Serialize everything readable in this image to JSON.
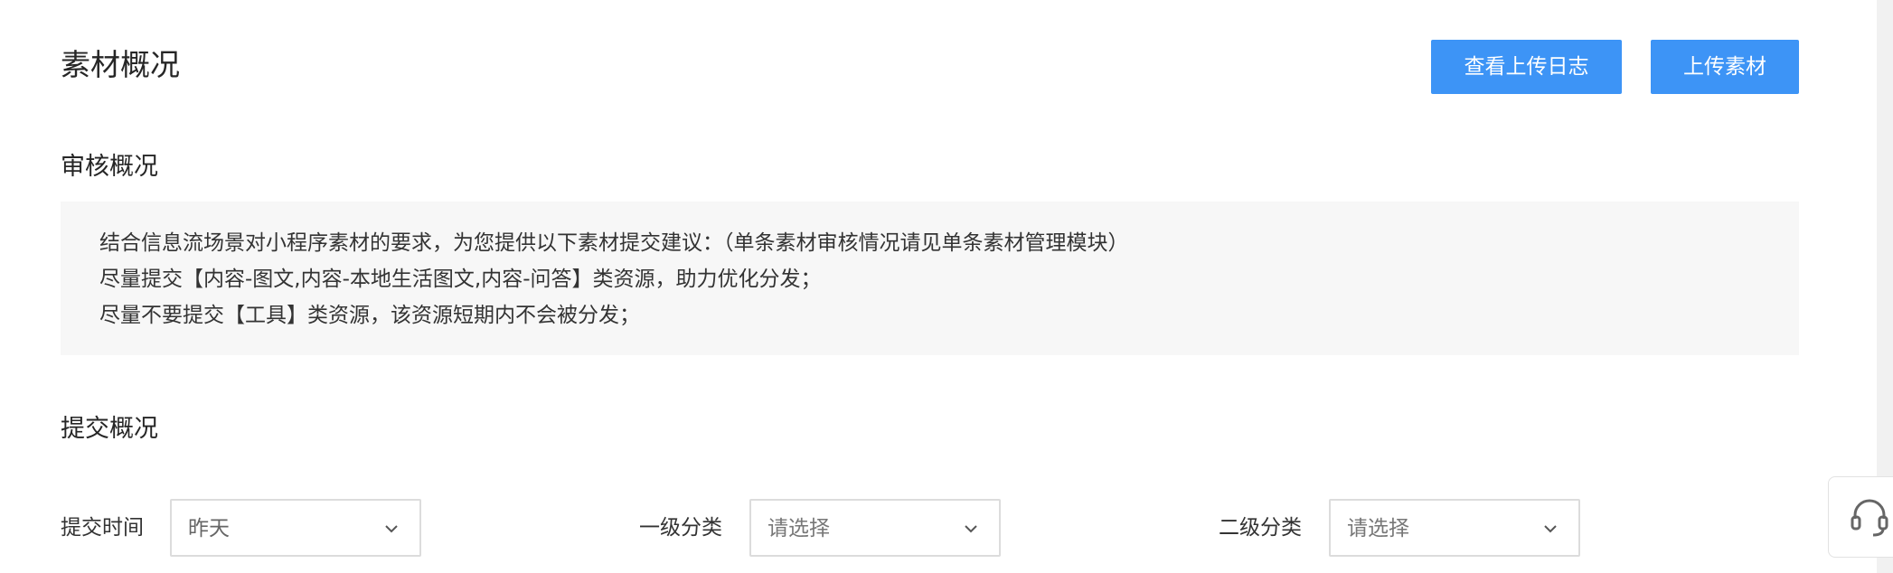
{
  "header": {
    "title": "素材概况",
    "view_log_label": "查看上传日志",
    "upload_label": "上传素材"
  },
  "review": {
    "title": "审核概况",
    "lines": [
      "结合信息流场景对小程序素材的要求，为您提供以下素材提交建议：（单条素材审核情况请见单条素材管理模块）",
      "尽量提交【内容-图文,内容-本地生活图文,内容-问答】类资源，助力优化分发；",
      "尽量不要提交【工具】类资源，该资源短期内不会被分发；"
    ]
  },
  "submit": {
    "title": "提交概况",
    "filters": {
      "time_label": "提交时间",
      "time_value": "昨天",
      "cat1_label": "一级分类",
      "cat1_placeholder": "请选择",
      "cat2_label": "二级分类",
      "cat2_placeholder": "请选择"
    }
  },
  "icons": {
    "chevron": "chevron-down-icon",
    "support": "headset-icon"
  },
  "colors": {
    "primary_button": "#3d94f6",
    "notice_bg": "#f7f7f7",
    "border": "#dcdcdc"
  }
}
